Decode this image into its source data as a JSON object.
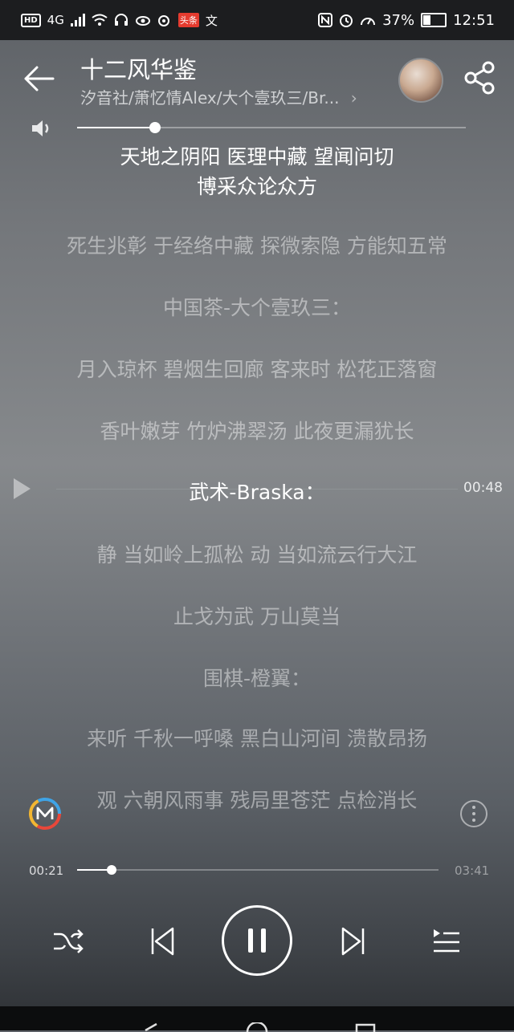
{
  "status_bar": {
    "hd": "HD",
    "network": "4G",
    "app_badge": "头条",
    "ime": "文",
    "battery": "37%",
    "battery_level": 0.37,
    "time": "12:51"
  },
  "header": {
    "title": "十二风华鉴",
    "artists": "汐音社/萧忆情Alex/大个壹玖三/Br...",
    "artists_chevron": "›"
  },
  "volume": {
    "level": 0.2
  },
  "lyrics": {
    "lines": [
      {
        "text": "天地之阴阳 医理中藏 望闻问切",
        "current": false,
        "bright": true
      },
      {
        "text": "博采众论众方",
        "current": false,
        "bright": true
      },
      {
        "text": "死生兆彰 于经络中藏 探微索隐 方能知五常",
        "current": false
      },
      {
        "text": "中国茶-大个壹玖三：",
        "current": false
      },
      {
        "text": "月入琼杯 碧烟生回廊 客来时 松花正落窗",
        "current": false
      },
      {
        "text": "香叶嫩芽 竹炉沸翠汤 此夜更漏犹长",
        "current": false
      },
      {
        "text": "武术-Braska：",
        "current": true
      },
      {
        "text": "静 当如岭上孤松 动 当如流云行大江",
        "current": false
      },
      {
        "text": "止戈为武 万山莫当",
        "current": false
      },
      {
        "text": "围棋-橙翼：",
        "current": false
      },
      {
        "text": "来听 千秋一呼嗓 黑白山河间 溃散昂扬",
        "current": false
      },
      {
        "text": "观 六朝风雨事 残局里苍茫 点检消长",
        "current": false
      }
    ],
    "line_time": "00:48"
  },
  "progress": {
    "current": "00:21",
    "total": "03:41",
    "fraction": 0.095
  },
  "icons": {
    "back": "back-arrow-icon",
    "share": "share-icon",
    "volume": "speaker-icon",
    "shuffle": "shuffle-icon",
    "prev": "previous-icon",
    "pause": "pause-icon",
    "next": "next-icon",
    "playlist": "playlist-icon",
    "more": "more-icon",
    "logo": "m-logo-icon"
  }
}
